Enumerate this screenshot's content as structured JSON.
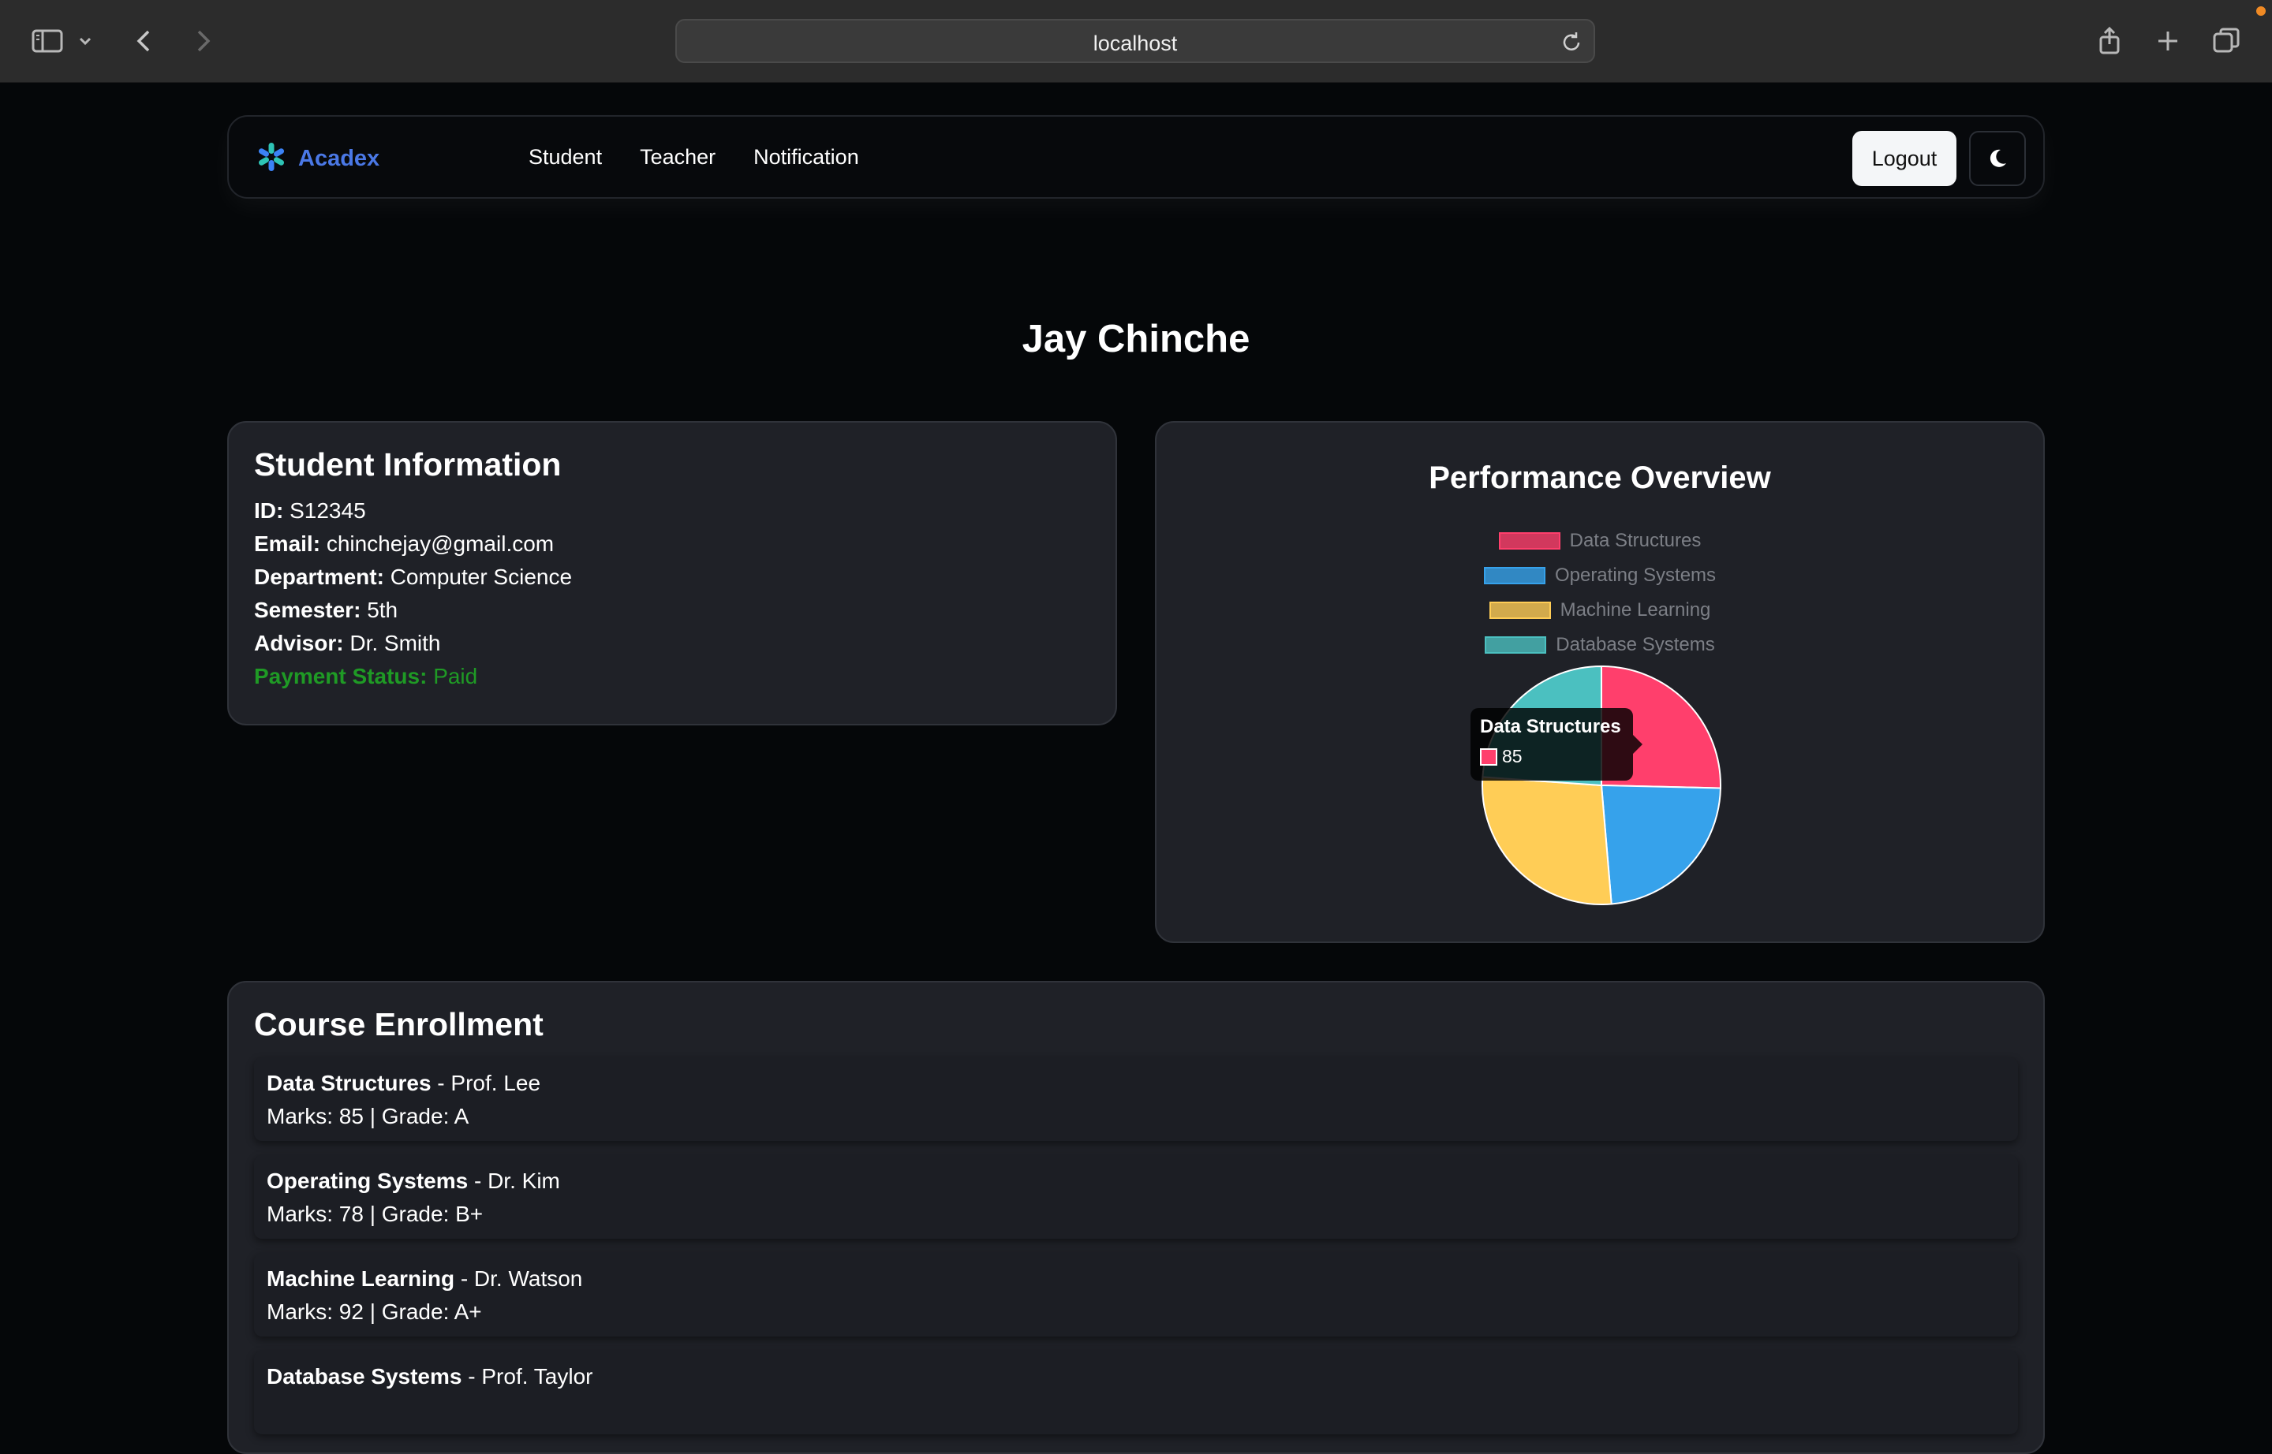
{
  "browser": {
    "url": "localhost"
  },
  "navbar": {
    "brand": "Acadex",
    "links": [
      "Student",
      "Teacher",
      "Notification"
    ],
    "logout_label": "Logout"
  },
  "student": {
    "name": "Jay Chinche",
    "info_title": "Student Information",
    "fields": [
      {
        "label": "ID:",
        "value": "S12345"
      },
      {
        "label": "Email:",
        "value": "chinchejay@gmail.com"
      },
      {
        "label": "Department:",
        "value": "Computer Science"
      },
      {
        "label": "Semester:",
        "value": "5th"
      },
      {
        "label": "Advisor:",
        "value": "Dr. Smith"
      },
      {
        "label": "Payment Status:",
        "value": "Paid"
      }
    ]
  },
  "performance": {
    "title": "Performance Overview",
    "tooltip": {
      "label": "Data Structures",
      "value": "85"
    }
  },
  "chart_data": {
    "type": "pie",
    "title": "Performance Overview",
    "categories": [
      "Data Structures",
      "Operating Systems",
      "Machine Learning",
      "Database Systems"
    ],
    "values": [
      85,
      78,
      92,
      80
    ],
    "colors": [
      "#ff3f6c",
      "#36a2eb",
      "#ffcd56",
      "#4bc0c0"
    ],
    "legend": "top"
  },
  "courses": {
    "title": "Course Enrollment",
    "items": [
      {
        "name": "Data Structures",
        "teacher": " - Prof. Lee",
        "detail": "Marks: 85 | Grade: A"
      },
      {
        "name": "Operating Systems",
        "teacher": " - Dr. Kim",
        "detail": "Marks: 78 | Grade: B+"
      },
      {
        "name": "Machine Learning",
        "teacher": " - Dr. Watson",
        "detail": "Marks: 92 | Grade: A+"
      },
      {
        "name": "Database Systems",
        "teacher": " - Prof. Taylor",
        "detail": ""
      }
    ]
  }
}
